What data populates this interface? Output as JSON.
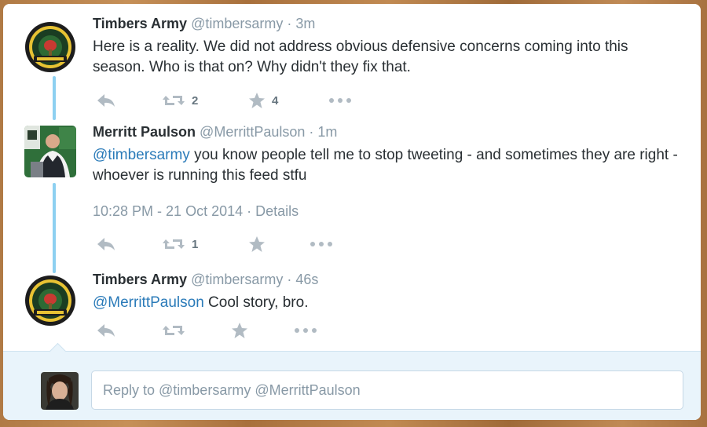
{
  "tweets": [
    {
      "name": "Timbers Army",
      "handle": "@timbersarmy",
      "time": "· 3m",
      "text": "Here is a reality. We did not address obvious defensive concerns coming into this season. Who is that on? Why didn't they fix that.",
      "retweets": "2",
      "favorites": "4"
    },
    {
      "name": "Merritt Paulson",
      "handle": "@MerrittPaulson",
      "time": "· 1m",
      "mention": "@timbersarmy",
      "text": " you know people tell me to stop tweeting - and sometimes they are right - whoever is running this feed stfu",
      "timestamp": "10:28 PM - 21 Oct 2014 · Details",
      "retweets": "1"
    },
    {
      "name": "Timbers Army",
      "handle": "@timbersarmy",
      "time": "· 46s",
      "mention": "@MerrittPaulson",
      "text": " Cool story, bro."
    }
  ],
  "reply": {
    "placeholder": "Reply to @timbersarmy @MerrittPaulson"
  },
  "colors": {
    "accent": "#2b7bb9",
    "thread_line": "#8dd0f1",
    "reply_bg": "#e9f4fb"
  },
  "icons": [
    "reply-icon",
    "retweet-icon",
    "favorite-icon",
    "more-icon",
    "timbers-army-logo",
    "merritt-avatar",
    "user-avatar"
  ]
}
